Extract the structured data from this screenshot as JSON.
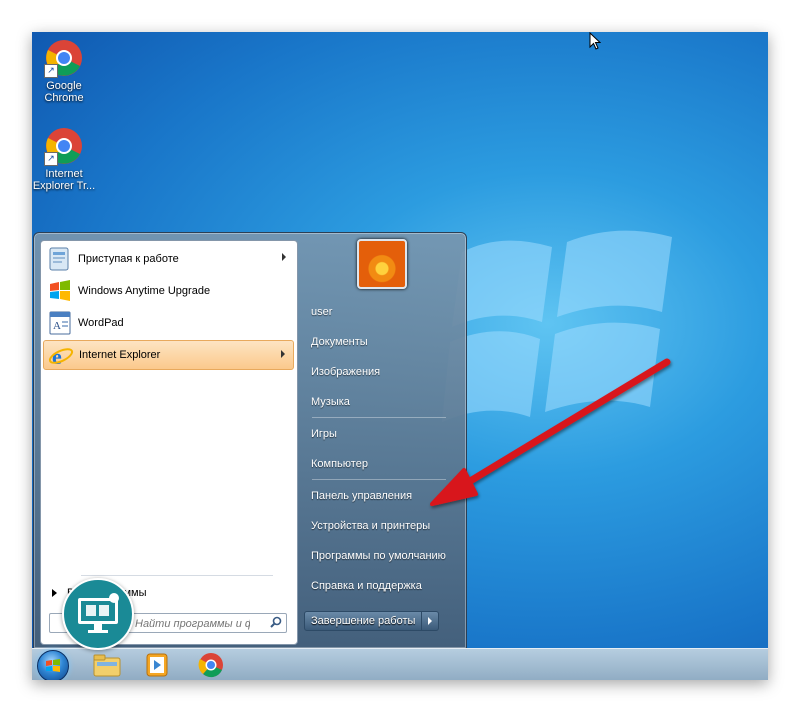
{
  "desktop": {
    "icons": [
      {
        "label": "Google Chrome"
      },
      {
        "label": "Internet Explorer Tr..."
      }
    ]
  },
  "start_menu": {
    "programs": [
      {
        "label": "Приступая к работе",
        "has_submenu": true
      },
      {
        "label": "Windows Anytime Upgrade",
        "has_submenu": false
      },
      {
        "label": "WordPad",
        "has_submenu": false
      },
      {
        "label": "Internet Explorer",
        "has_submenu": true,
        "highlighted": true
      }
    ],
    "all_programs_label": "Все программы",
    "search_placeholder": "Найти программы и файлы",
    "right_items": [
      "user",
      "Документы",
      "Изображения",
      "Музыка",
      "Игры",
      "Компьютер",
      "Панель управления",
      "Устройства и принтеры",
      "Программы по умолчанию",
      "Справка и поддержка"
    ],
    "shutdown_label": "Завершение работы"
  },
  "taskbar": {
    "items": [
      "start-orb",
      "explorer-icon",
      "media-player-icon",
      "chrome-icon"
    ]
  },
  "colors": {
    "accent_red": "#d8151b",
    "highlight_orange": "#fbc98c",
    "desktop_blue": "#1976c9"
  }
}
